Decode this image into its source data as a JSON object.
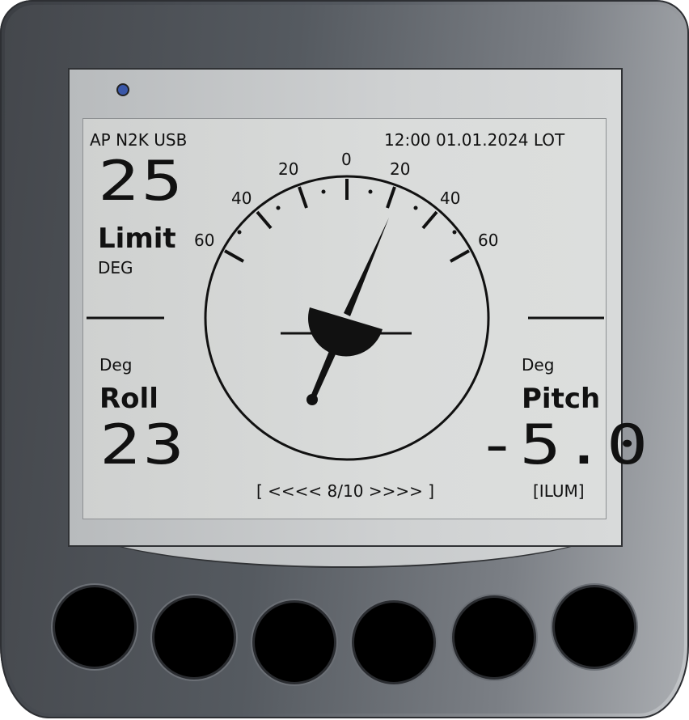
{
  "header": {
    "left": "AP N2K USB",
    "right": "12:00 01.01.2024 LOT"
  },
  "limit": {
    "value": "25",
    "label": "Limit",
    "unit": "DEG"
  },
  "roll": {
    "unit": "Deg",
    "label": "Roll",
    "value": "23"
  },
  "pitch": {
    "unit": "Deg",
    "label": "Pitch",
    "value": "-5.0"
  },
  "pager": "[ <<<< 8/10 >>>> ]",
  "ilum": "[ILUM]",
  "gauge": {
    "scale_labels": [
      "60",
      "40",
      "20",
      "0",
      "20",
      "40",
      "60"
    ],
    "needle_deg": 23
  },
  "buttons": [
    "button-1",
    "button-2",
    "button-3",
    "button-4",
    "button-5",
    "button-6"
  ],
  "colors": {
    "lcd": "#dadcdb",
    "ink": "#111111",
    "led": "#3a57a8",
    "bezel": "#555a61"
  }
}
